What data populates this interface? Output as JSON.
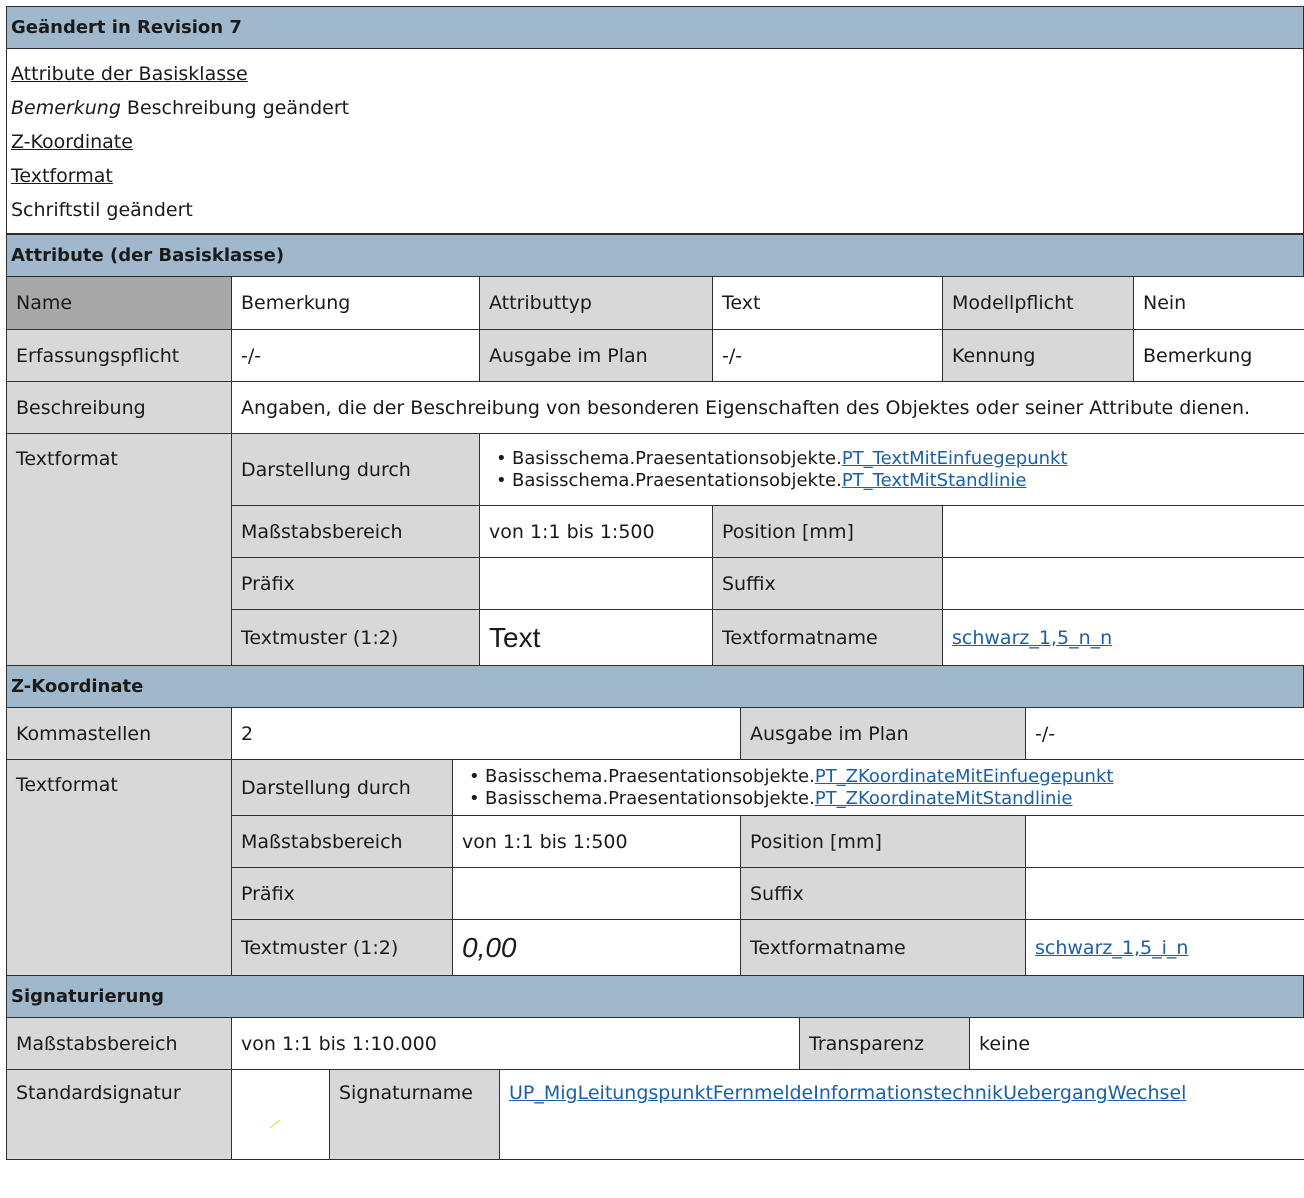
{
  "revision": {
    "header": "Geändert in Revision 7",
    "lines": [
      {
        "text": "Attribute der Basisklasse",
        "style": "underline"
      },
      {
        "italic": "Bemerkung",
        "text": " Beschreibung geändert"
      },
      {
        "text": "Z-Koordinate",
        "style": "underline"
      },
      {
        "text": "Textformat",
        "style": "underline"
      },
      {
        "text": "Schriftstil geändert",
        "style": "plain"
      }
    ]
  },
  "attribute": {
    "header": "Attribute (der Basisklasse)",
    "name_label": "Name",
    "name_value": "Bemerkung",
    "typ_label": "Attributtyp",
    "typ_value": "Text",
    "pflicht_label": "Modellpflicht",
    "pflicht_value": "Nein",
    "erf_label": "Erfassungspflicht",
    "erf_value": "-/-",
    "ausgabe_label": "Ausgabe im Plan",
    "ausgabe_value": "-/-",
    "kennung_label": "Kennung",
    "kennung_value": "Bemerkung",
    "beschr_label": "Beschreibung",
    "beschr_value": "Angaben, die der Beschreibung von besonderen Eigenschaften des Objektes oder seiner Attribute dienen.",
    "textformat_label": "Textformat",
    "darst_label": "Darstellung durch",
    "darst_prefix": "Basisschema.Praesentationsobjekte.",
    "darst_links": [
      "PT_TextMitEinfuegepunkt",
      "PT_TextMitStandlinie"
    ],
    "mass_label": "Maßstabsbereich",
    "mass_value": "von 1:1 bis 1:500",
    "pos_label": "Position [mm]",
    "pos_value": "",
    "praefix_label": "Präfix",
    "praefix_value": "",
    "suffix_label": "Suffix",
    "suffix_value": "",
    "muster_label": "Textmuster (1:2)",
    "muster_value": "Text",
    "tfname_label": "Textformatname",
    "tfname_value": "schwarz_1,5_n_n"
  },
  "zkoord": {
    "header": "Z-Koordinate",
    "komma_label": "Kommastellen",
    "komma_value": "2",
    "ausgabe_label": "Ausgabe im Plan",
    "ausgabe_value": "-/-",
    "textformat_label": "Textformat",
    "darst_label": "Darstellung durch",
    "darst_prefix": "Basisschema.Praesentationsobjekte.",
    "darst_links": [
      "PT_ZKoordinateMitEinfuegepunkt",
      "PT_ZKoordinateMitStandlinie"
    ],
    "mass_label": "Maßstabsbereich",
    "mass_value": "von 1:1 bis 1:500",
    "pos_label": "Position [mm]",
    "pos_value": "",
    "praefix_label": "Präfix",
    "praefix_value": "",
    "suffix_label": "Suffix",
    "suffix_value": "",
    "muster_label": "Textmuster (1:2)",
    "muster_value": "0,00",
    "tfname_label": "Textformatname",
    "tfname_value": "schwarz_1,5_i_n"
  },
  "signatur": {
    "header": "Signaturierung",
    "mass_label": "Maßstabsbereich",
    "mass_value": "von 1:1 bis 1:10.000",
    "transp_label": "Transparenz",
    "transp_value": "keine",
    "std_label": "Standardsignatur",
    "name_label": "Signaturname",
    "name_value": "UP_MigLeitungspunktFernmeldeInformationstechnikUebergangWechsel",
    "symbol_icon": "signature-preview-icon",
    "symbol_color": "#e8e04a"
  }
}
